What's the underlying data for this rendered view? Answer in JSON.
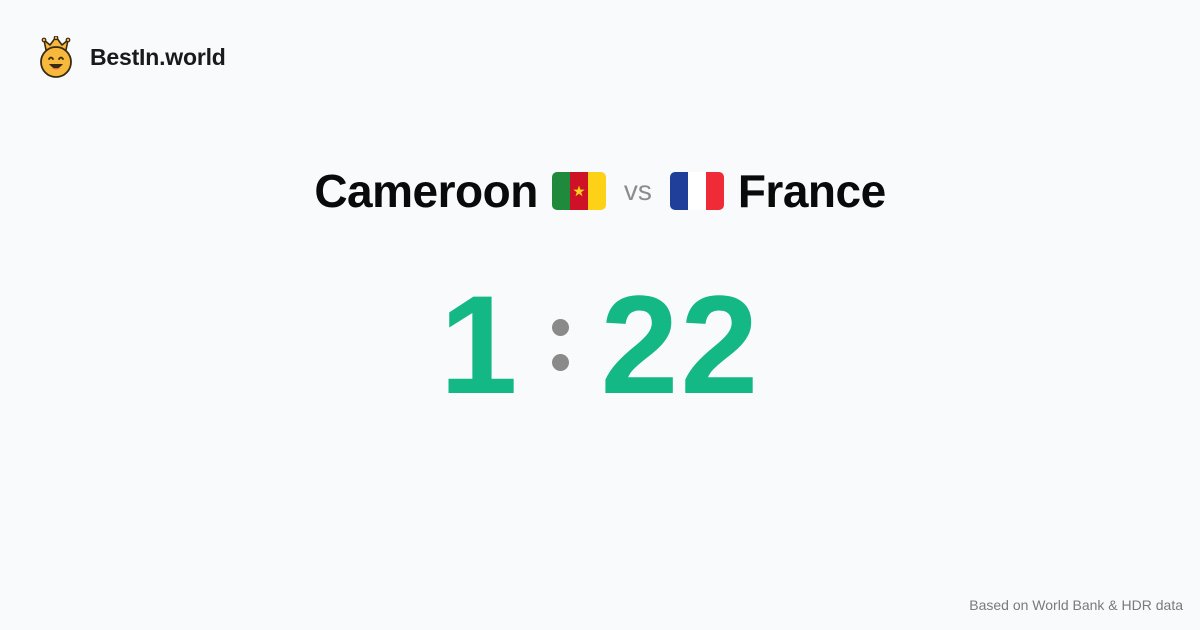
{
  "brand": {
    "name": "BestIn.world",
    "logo_icon": "crowned-smiley-icon"
  },
  "comparison": {
    "left_country": {
      "name": "Cameroon",
      "flag_icon": "cameroon-flag-icon",
      "flag_colors": [
        "#1f8a3b",
        "#ce1126",
        "#fcd116"
      ]
    },
    "vs_label": "vs",
    "right_country": {
      "name": "France",
      "flag_icon": "france-flag-icon",
      "flag_colors": [
        "#1f3f9a",
        "#ffffff",
        "#ef2b37"
      ]
    }
  },
  "score": {
    "left": "1",
    "right": "22",
    "color": "#14b884"
  },
  "footer": {
    "note": "Based on World Bank & HDR data"
  },
  "colors": {
    "background": "#f8fafc",
    "accent": "#14b884",
    "muted": "#8a8a8a"
  }
}
